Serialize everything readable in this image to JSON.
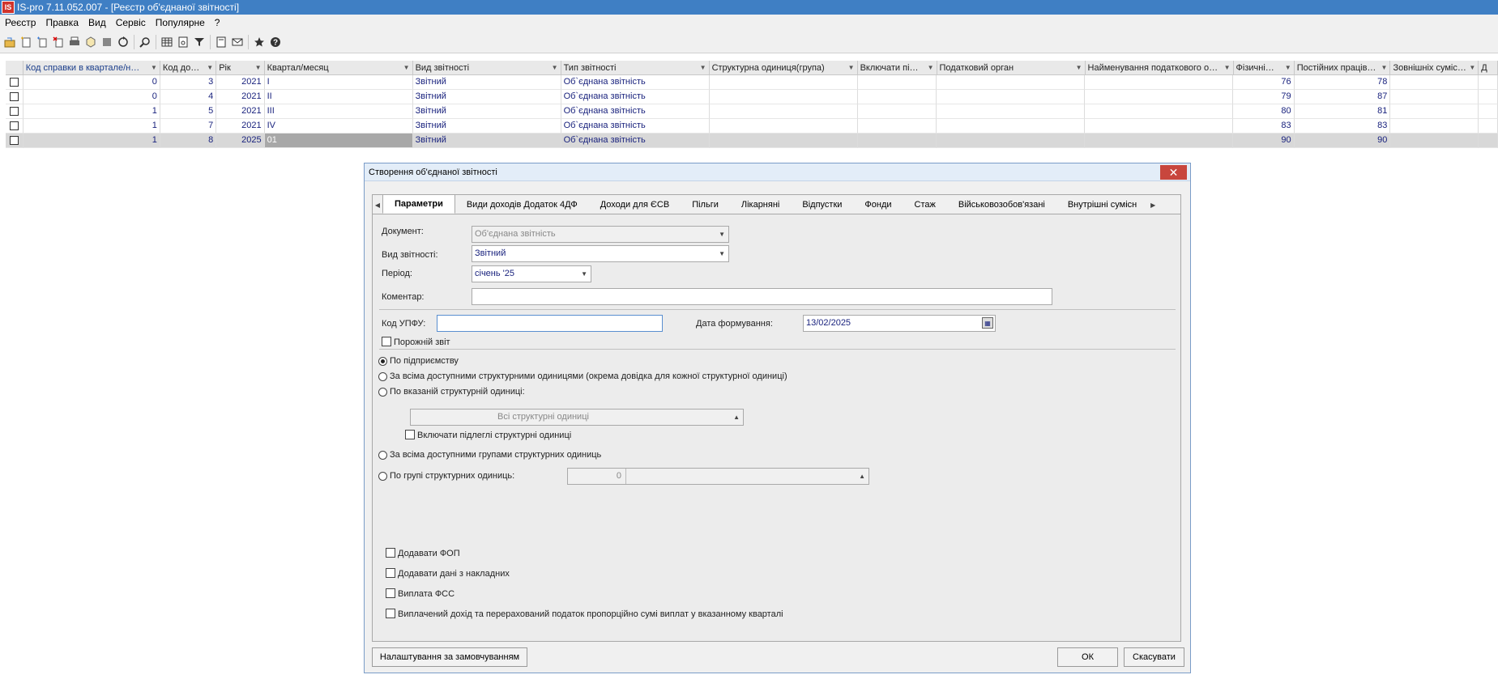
{
  "app": {
    "title": "IS-pro 7.11.052.007 - [Реєстр об'єднаної звітності]",
    "logo": "IS"
  },
  "menu": [
    "Реєстр",
    "Правка",
    "Вид",
    "Сервіс",
    "Популярне",
    "?"
  ],
  "toolbar_icons": [
    "open-icon",
    "new-icon",
    "copy-icon",
    "delete-icon",
    "print-icon",
    "package-icon",
    "stamp-icon",
    "refresh-icon",
    "search-icon",
    "table-icon",
    "calc-icon",
    "filter-icon",
    "doc-icon",
    "mail-icon",
    "star-icon",
    "help-icon"
  ],
  "grid": {
    "columns": [
      {
        "label": "Код справки в квартале/н…",
        "sorted": true
      },
      {
        "label": "Код до…"
      },
      {
        "label": "Рік"
      },
      {
        "label": "Квартал/месяц"
      },
      {
        "label": "Вид звітності"
      },
      {
        "label": "Тип звітності"
      },
      {
        "label": "Структурна одиниця(група)"
      },
      {
        "label": "Включати пі…"
      },
      {
        "label": "Податковий орган"
      },
      {
        "label": "Найменування податкового о…"
      },
      {
        "label": "Фізичні…"
      },
      {
        "label": "Постійних праців…"
      },
      {
        "label": "Зовнішніх суміс…"
      },
      {
        "label": "Д"
      }
    ],
    "rows": [
      [
        "0",
        "3",
        "2021",
        "I",
        "Звітний",
        "Об`єднана звітність",
        "",
        "",
        "",
        "",
        "76",
        "78",
        ""
      ],
      [
        "0",
        "4",
        "2021",
        "II",
        "Звітний",
        "Об`єднана звітність",
        "",
        "",
        "",
        "",
        "79",
        "87",
        ""
      ],
      [
        "1",
        "5",
        "2021",
        "III",
        "Звітний",
        "Об`єднана звітність",
        "",
        "",
        "",
        "",
        "80",
        "81",
        ""
      ],
      [
        "1",
        "7",
        "2021",
        "IV",
        "Звітний",
        "Об`єднана звітність",
        "",
        "",
        "",
        "",
        "83",
        "83",
        ""
      ],
      [
        "1",
        "8",
        "2025",
        "01",
        "Звітний",
        "Об`єднана звітність",
        "",
        "",
        "",
        "",
        "90",
        "90",
        ""
      ]
    ]
  },
  "dialog": {
    "title": "Створення об'єднаної звітності",
    "tabs": [
      "Параметри",
      "Види доходів Додаток 4ДФ",
      "Доходи для ЄСВ",
      "Пільги",
      "Лікарняні",
      "Відпустки",
      "Фонди",
      "Стаж",
      "Військовозобов'язані",
      "Внутрішні сумісн"
    ],
    "document_label": "Документ:",
    "document_value": "Об'єднана звітність",
    "report_type_label": "Вид звітності:",
    "report_type_value": "Звітний",
    "period_label": "Період:",
    "period_value": "січень   '25",
    "comment_label": "Коментар:",
    "comment_value": "",
    "upfu_label": "Код УПФУ:",
    "upfu_value": "",
    "date_label": "Дата формування:",
    "date_value": "13/02/2025",
    "empty_report": "Порожній звіт",
    "radio_enterprise": "По підприємству",
    "radio_all_units": "За всіма доступними структурними одиницями (окрема довідка для кожної структурної одиниці)",
    "radio_unit": "По вказаній структурній одиниці:",
    "unit_value": "Всі структурні одиниці",
    "include_sub": "Включати підлеглі структурні одиниці",
    "radio_all_groups": "За всіма доступними групами структурних одиниць",
    "radio_group": "По групі структурних одиниць:",
    "group_code": "0",
    "group_name": "",
    "chk_fop": "Додавати ФОП",
    "chk_invoices": "Додавати дані з накладних",
    "chk_fss": "Виплата ФСС",
    "chk_paid": "Виплачений дохід та перерахований податок пропорційно сумі виплат у вказанному кварталі",
    "btn_defaults": "Налаштування за замовчуванням",
    "btn_ok": "ОК",
    "btn_cancel": "Скасувати"
  }
}
